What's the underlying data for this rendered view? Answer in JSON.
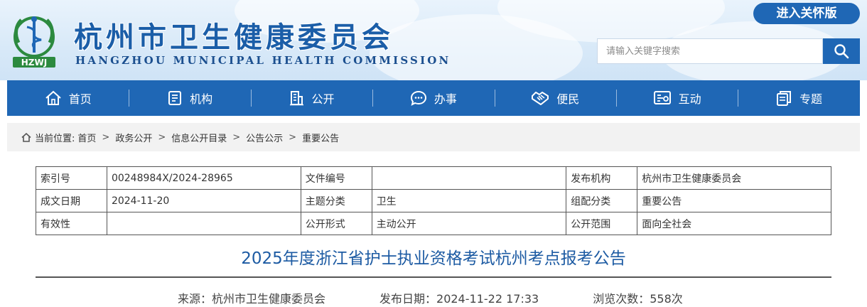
{
  "header": {
    "logo_text": "HZWJ",
    "title": "杭州市卫生健康委员会",
    "subtitle": "HANGZHOU MUNICIPAL HEALTH COMMISSION",
    "care_button": "进入关怀版",
    "search_placeholder": "请输入关键字搜索",
    "brand_color": "#1f67b5"
  },
  "nav": {
    "items": [
      {
        "label": "首页",
        "icon": "home-icon"
      },
      {
        "label": "机构",
        "icon": "org-icon"
      },
      {
        "label": "公开",
        "icon": "building-icon"
      },
      {
        "label": "办事",
        "icon": "chat-icon"
      },
      {
        "label": "便民",
        "icon": "handshake-icon"
      },
      {
        "label": "互动",
        "icon": "interact-icon"
      },
      {
        "label": "专题",
        "icon": "topic-icon"
      }
    ]
  },
  "breadcrumb": {
    "prefix": "当前位置:",
    "items": [
      "首页",
      "政务公开",
      "信息公开目录",
      "公告公示",
      "重要公告"
    ]
  },
  "meta": {
    "rows": [
      [
        {
          "key": "索引号",
          "value": "00248984X/2024-28965"
        },
        {
          "key": "文件编号",
          "value": ""
        },
        {
          "key": "发布机构",
          "value": "杭州市卫生健康委员会"
        }
      ],
      [
        {
          "key": "成文日期",
          "value": "2024-11-20"
        },
        {
          "key": "主题分类",
          "value": "卫生"
        },
        {
          "key": "组配分类",
          "value": "重要公告"
        }
      ],
      [
        {
          "key": "有效性",
          "value": ""
        },
        {
          "key": "公开形式",
          "value": "主动公开"
        },
        {
          "key": "公开范围",
          "value": "面向全社会"
        }
      ]
    ]
  },
  "article": {
    "title": "2025年度浙江省护士执业资格考试杭州考点报考公告",
    "source": "来源：杭州市卫生健康委员会",
    "date": "发布日期：2024-11-22 17:33",
    "views": "浏览次数：558次"
  }
}
